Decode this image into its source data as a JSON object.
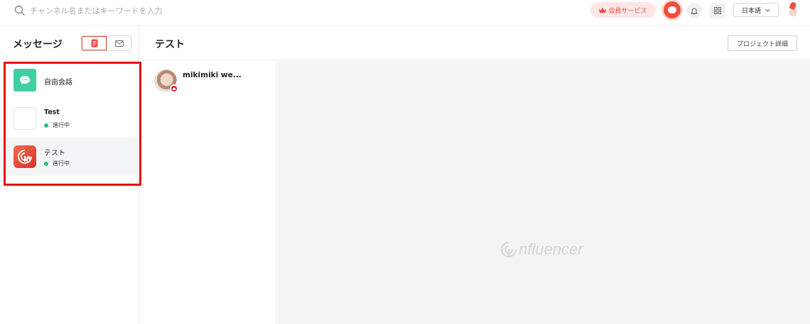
{
  "topbar": {
    "search_placeholder": "チャンネル名またはキーワードを入力",
    "member_service_label": "会員サービス",
    "language_label": "日本語"
  },
  "sidebar": {
    "title": "メッセージ",
    "conversations": [
      {
        "name": "自由会話",
        "status": ""
      },
      {
        "name": "Test",
        "status": "進行中"
      },
      {
        "name": "テスト",
        "status": "進行中"
      }
    ]
  },
  "main": {
    "title": "テスト",
    "project_detail_label": "プロジェクト詳細",
    "members": [
      {
        "name": "mikimiki we..."
      }
    ],
    "watermark": "nfluencer"
  },
  "colors": {
    "accent": "#ef4d3f",
    "status_green": "#25c176",
    "free_chat_green": "#3fcfa2"
  }
}
